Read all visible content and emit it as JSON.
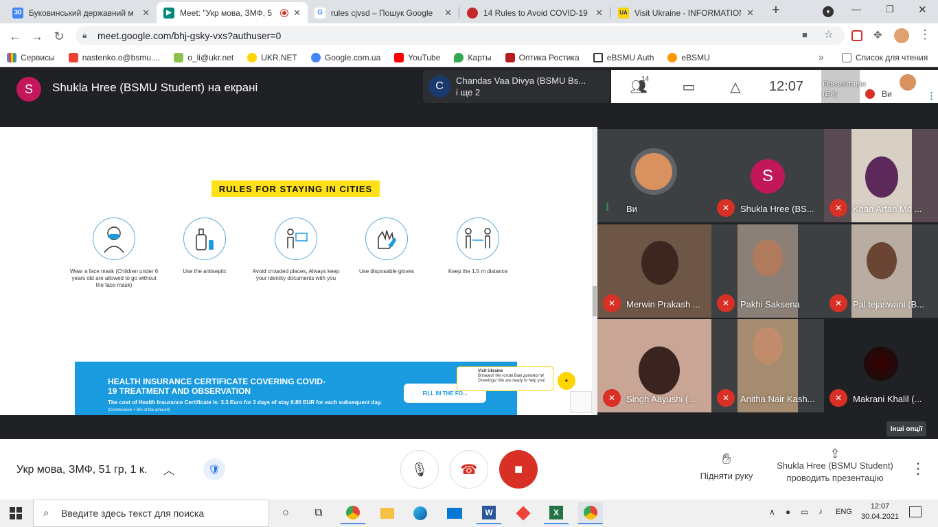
{
  "browser": {
    "tabs": [
      {
        "title": "Буковинський державний м",
        "fav": "30",
        "color": "#4285f4"
      },
      {
        "title": "Meet: \"Укр мова, ЗМФ, 5",
        "fav": "",
        "color": "#00897b"
      },
      {
        "title": "rules cjvsd – Пошук Google",
        "fav": "G",
        "color": "#4285f4"
      },
      {
        "title": "14 Rules to Avoid COVID-19",
        "fav": "",
        "color": "#c62828"
      },
      {
        "title": "Visit Ukraine - INFORMATION",
        "fav": "UA",
        "color": "#ffd400"
      }
    ],
    "url": "meet.google.com/bhj-gsky-vxs?authuser=0",
    "bookmarks": [
      "Сервисы",
      "nastenko.o@bsmu....",
      "o_li@ukr.net",
      "UKR.NET",
      "Google.com.ua",
      "YouTube",
      "Карты",
      "Оптика Ростика",
      "eBSMU Auth",
      "eBSMU"
    ],
    "reading_list": "Список для чтения"
  },
  "meet": {
    "presenter_initial": "S",
    "presenter_title": "Shukla Hree (BSMU Student) на екрані",
    "chat_popup": {
      "initial": "C",
      "line1": "Chandas Vaa Divya (BSMU Bs...",
      "line2": "і ще 2"
    },
    "participants_count": "14",
    "clock": "12:07",
    "self_thumb_label": "Презентація (Ви)",
    "self_label": "Ви",
    "slide": {
      "title": "RULES FOR STAYING IN CITIES",
      "rules": [
        "Wear a face mask (Children under 6 years old are allowed to go without the face mask)",
        "Use the antiseptic",
        "Avoid crowded places, Always keep your identity documents with you",
        "Use disposable gloves",
        "Keep the 1.5 m distance"
      ],
      "banner_title": "HEALTH INSURANCE CERTIFICATE COVERING COVID-19 TREATMENT AND OBSERVATION",
      "banner_text": "The cost of Health Insurance Certificate is: 3.3 Euro for 3 days of stay 0.80 EUR for each subsequent day.",
      "banner_note": "(Commission + 8% of the amount)",
      "fill_button": "FILL IN THE FO...",
      "vu_chat_title": "Visit Ukraine",
      "vu_chat_text": "Вітаємо! Ми готові Вам допомогти! Greetings! We are ready to help you!"
    },
    "tiles": [
      {
        "name": "Ви",
        "type": "self"
      },
      {
        "name": "Shukla Hree (BS...",
        "type": "initial",
        "initial": "S"
      },
      {
        "name": "Khan Arfan Md ...",
        "type": "video",
        "color": "#5a4a52"
      },
      {
        "name": "Merwin Prakash ...",
        "type": "video",
        "color": "#6d5646"
      },
      {
        "name": "Pakhi Saksena",
        "type": "video",
        "color": "#8a8077"
      },
      {
        "name": "Pal tejaswani (B...",
        "type": "video",
        "color": "#4b3b33"
      },
      {
        "name": "Singh Aayushi (...",
        "type": "video",
        "color": "#c8a594"
      },
      {
        "name": "Anitha Nair Kash...",
        "type": "video",
        "color": "#a58c70"
      },
      {
        "name": "Makrani Khalil (...",
        "type": "dark",
        "color": "#1a1a1a"
      }
    ],
    "more_options": "Інші опції",
    "meeting_name": "Укр мова, ЗМФ, 51 гр, 1 к.",
    "raise_hand": "Підняти руку",
    "presenting_line1": "Shukla Hree (BSMU Student)",
    "presenting_line2": "проводить презентацію"
  },
  "taskbar": {
    "search_placeholder": "Введите здесь текст для поиска",
    "lang": "ENG",
    "time": "12:07",
    "date": "30.04.2021"
  }
}
